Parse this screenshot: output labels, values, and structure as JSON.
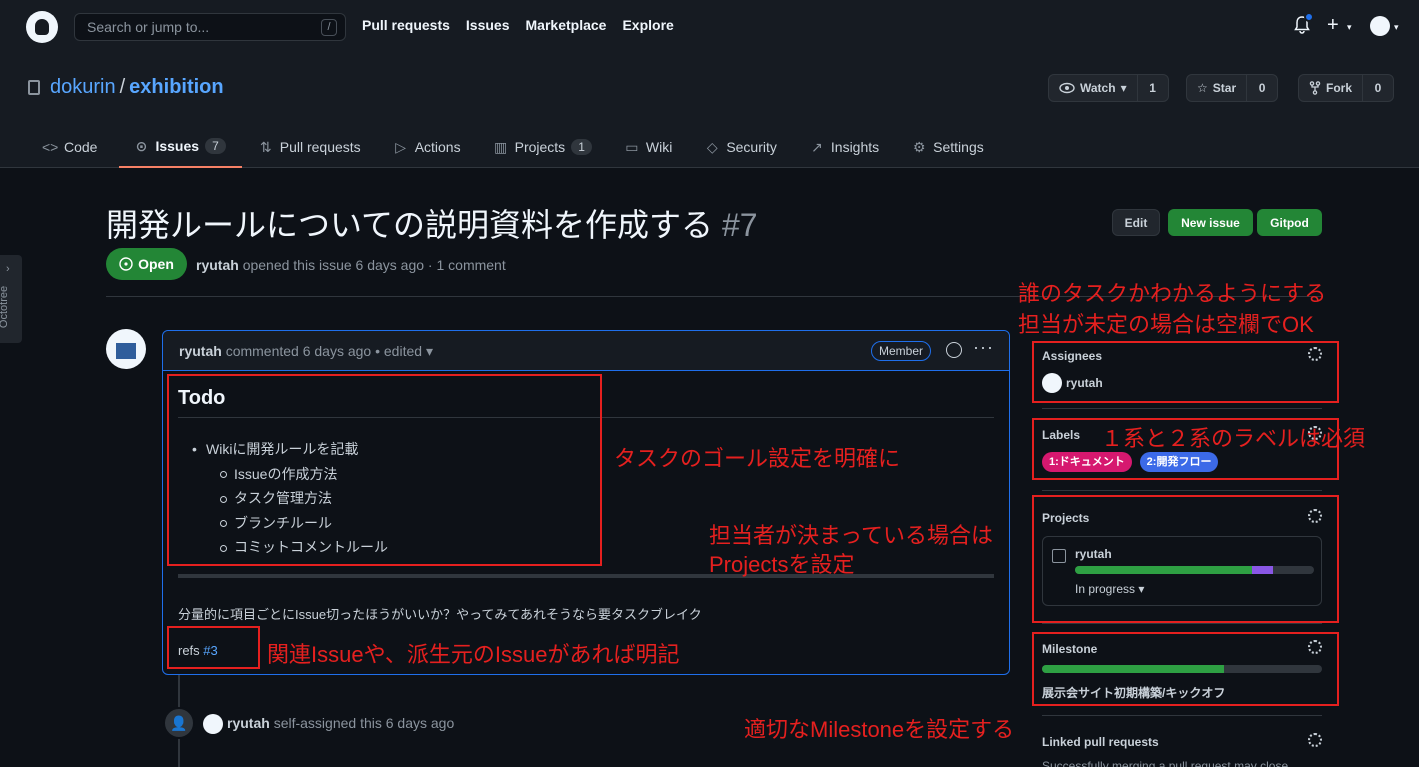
{
  "topbar": {
    "search_placeholder": "Search or jump to...",
    "search_key": "/",
    "nav": [
      "Pull requests",
      "Issues",
      "Marketplace",
      "Explore"
    ],
    "plus": "+"
  },
  "repo": {
    "owner": "dokurin",
    "separator": "/",
    "name": "exhibition",
    "watch_label": "Watch",
    "watch_count": "1",
    "star_label": "Star",
    "star_count": "0",
    "fork_label": "Fork",
    "fork_count": "0"
  },
  "tabs": [
    {
      "label": "Code",
      "icon": "code-icon"
    },
    {
      "label": "Issues",
      "icon": "issue-opened-icon",
      "counter": "7"
    },
    {
      "label": "Pull requests",
      "icon": "git-pull-request-icon"
    },
    {
      "label": "Actions",
      "icon": "play-icon"
    },
    {
      "label": "Projects",
      "icon": "project-icon",
      "counter": "1"
    },
    {
      "label": "Wiki",
      "icon": "book-icon"
    },
    {
      "label": "Security",
      "icon": "shield-icon"
    },
    {
      "label": "Insights",
      "icon": "graph-icon"
    },
    {
      "label": "Settings",
      "icon": "gear-icon"
    }
  ],
  "octotree": {
    "label": "Octotree"
  },
  "issue": {
    "title": "開発ルールについての説明資料を作成する",
    "number": "#7",
    "state": "Open",
    "author": "ryutah",
    "meta": "opened this issue 6 days ago · 1 comment",
    "edit_label": "Edit",
    "new_issue_label": "New issue",
    "gitpod_label": "Gitpod"
  },
  "comment": {
    "author": "ryutah",
    "meta": "commented 6 days ago • edited",
    "badge": "Member",
    "heading": "Todo",
    "top_item": "Wikiに開発ルールを記載",
    "sub_items": [
      "Issueの作成方法",
      "タスク管理方法",
      "ブランチルール",
      "コミットコメントルール"
    ],
    "description": "分量的に項目ごとにIssue切ったほうがいいか？やってみてあれそうなら要タスクブレイク",
    "refs_prefix": "refs",
    "refs_link": "#3"
  },
  "timeline": {
    "author": "ryutah",
    "text": "self-assigned this 6 days ago"
  },
  "sidebar": {
    "assignees": {
      "title": "Assignees",
      "user": "ryutah"
    },
    "labels": {
      "title": "Labels",
      "items": [
        {
          "name": "1:ドキュメント",
          "color": "#d6186f"
        },
        {
          "name": "2:開発フロー",
          "color": "#3c6ae8"
        }
      ]
    },
    "projects": {
      "title": "Projects",
      "name": "ryutah",
      "status": "In progress",
      "done_fraction": 0.74,
      "in_progress_fraction": 0.09
    },
    "milestone": {
      "title": "Milestone",
      "name": "展示会サイト初期構築/キックオフ",
      "progress_fraction": 0.65
    },
    "linked": {
      "title": "Linked pull requests",
      "text": "Successfully merging a pull request may close"
    }
  },
  "annotations": {
    "assignee_line1": "誰のタスクかわかるようにする",
    "assignee_line2": "担当が未定の場合は空欄でOK",
    "labels": "１系と２系のラベルは必須",
    "goal": "タスクのゴール設定を明確に",
    "projects_line1": "担当者が決まっている場合は",
    "projects_line2": "Projectsを設定",
    "refs": "関連Issueや、派生元のIssueがあれば明記",
    "milestone": "適切なMilestoneを設定する"
  },
  "colors": {
    "annotation": "#e5201f",
    "open_green": "#238636",
    "link": "#58a6ff",
    "progress_purple": "#8957e5"
  }
}
